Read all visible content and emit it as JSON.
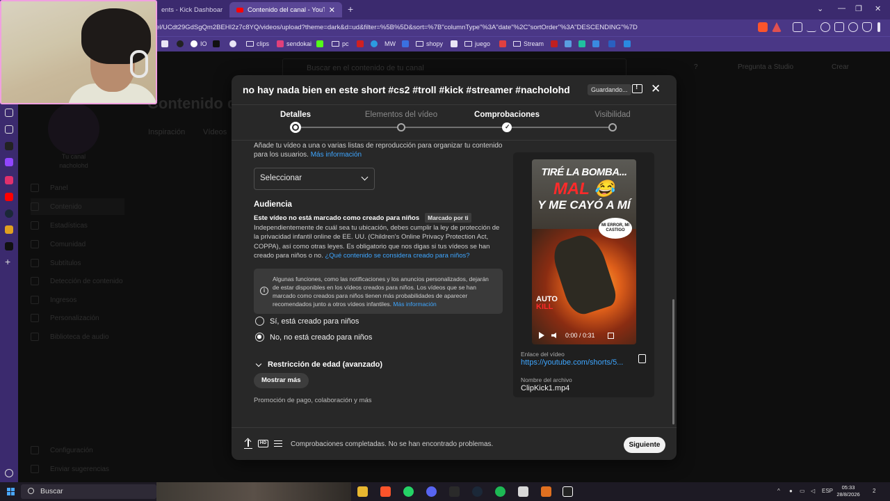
{
  "browser": {
    "tabs": [
      {
        "label": "ents - Kick Dashboard"
      },
      {
        "label": "Contenido del canal - YouTube S"
      }
    ],
    "url": "el/UCdt29GdSgQm2BEHI2z7c8YQ/videos/upload?theme=dark&d=ud&filter=%5B%5D&sort=%7B\"columnType\"%3A\"date\"%2C\"sortOrder\"%3A\"DESCENDING\"%7D",
    "bookmarks": [
      "IO",
      "clips",
      "sendokai",
      "pc",
      "MW",
      "shopy",
      "juego",
      "Stream"
    ]
  },
  "studio_bg": {
    "search_placeholder": "Buscar en el contenido de tu canal",
    "ask_studio": "Pregunta a Studio",
    "create": "Crear",
    "page_title": "Contenido de",
    "tabs": [
      "Inspiración",
      "Vídeos"
    ],
    "channel_label": "Tu canal",
    "channel_name": "nacholohd",
    "nav": [
      "Panel",
      "Contenido",
      "Estadísticas",
      "Comunidad",
      "Subtítulos",
      "Detección de contenido",
      "Ingresos",
      "Personalización",
      "Biblioteca de audio"
    ],
    "nav_bottom": [
      "Configuración",
      "Enviar sugerencias"
    ]
  },
  "modal": {
    "title": "no hay nada bien en este short #cs2 #troll #kick #streamer #nacholohd #r...",
    "saving_badge": "Guardando...",
    "steps": [
      {
        "label": "Detalles",
        "state": "current"
      },
      {
        "label": "Elementos del vídeo",
        "state": "pending"
      },
      {
        "label": "Comprobaciones",
        "state": "done"
      },
      {
        "label": "Visibilidad",
        "state": "pending"
      }
    ],
    "playlist_text": "Añade tu vídeo a una o varias listas de reproducción para organizar tu contenido para los usuarios.",
    "playlist_link": "Más información",
    "select_value": "Seleccionar",
    "audience_title": "Audiencia",
    "audience_sub": "Este vídeo no está marcado como creado para niños",
    "audience_badge": "Marcado por ti",
    "audience_desc": "Independientemente de cuál sea tu ubicación, debes cumplir la ley de protección de la privacidad infantil online de EE. UU. (Children's Online Privacy Protection Act, COPPA), así como otras leyes. Es obligatorio que nos digas si tus vídeos se han creado para niños o no.",
    "audience_link": "¿Qué contenido se considera creado para niños?",
    "info_text": "Algunas funciones, como las notificaciones y los anuncios personalizados, dejarán de estar disponibles en los vídeos creados para niños. Los vídeos que se han marcado como creados para niños tienen más probabilidades de aparecer recomendados junto a otros vídeos infantiles.",
    "info_link": "Más información",
    "radio_yes": "Sí, está creado para niños",
    "radio_no": "No, no está creado para niños",
    "radio_selected": "no",
    "age_restriction": "Restricción de edad (avanzado)",
    "show_more": "Mostrar más",
    "promo_text": "Promoción de pago, colaboración y más",
    "preview": {
      "thumb_line1": "TIRÉ LA BOMBA...",
      "thumb_line2": "MAL 😂",
      "thumb_line3": "Y ME CAYÓ A MÍ",
      "thumb_bubble": "MI ERROR, MI CASTIGO",
      "thumb_auto": "AUTO",
      "thumb_kill": "KILL",
      "time": "0:00 / 0:31",
      "link_label": "Enlace del vídeo",
      "link": "https://youtube.com/shorts/5...",
      "file_label": "Nombre del archivo",
      "file_name": "ClipKick1.mp4"
    },
    "footer_status": "Comprobaciones completadas. No se han encontrado problemas.",
    "next_button": "Siguiente"
  },
  "taskbar": {
    "search": "Buscar",
    "lang": "ESP",
    "time": "05:33",
    "date": "28/8/2026",
    "notif_count": "2"
  }
}
